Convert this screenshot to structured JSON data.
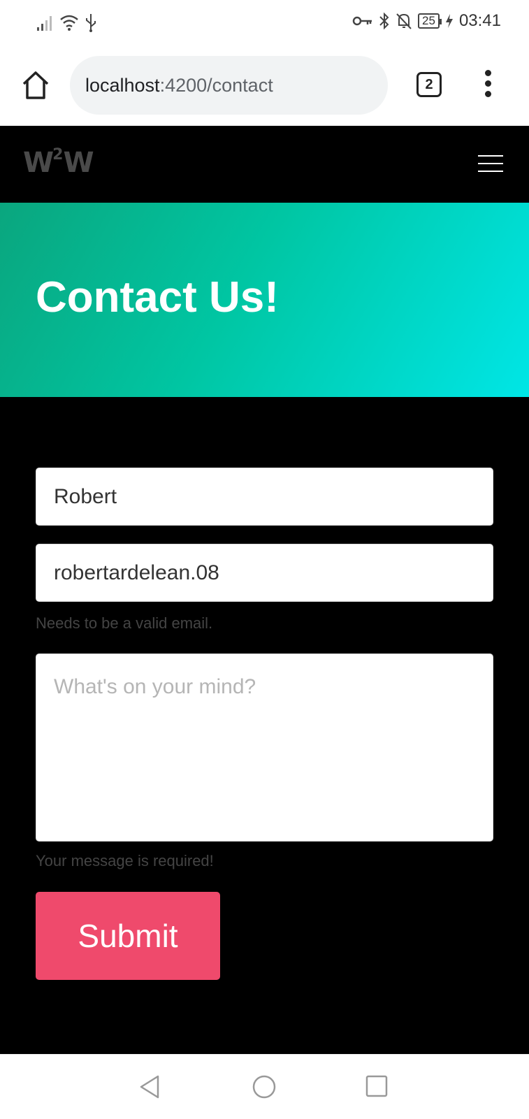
{
  "status_bar": {
    "time": "03:41",
    "battery": "25",
    "icons": [
      "signal-icon",
      "wifi-icon",
      "usb-icon",
      "vpn-key-icon",
      "bluetooth-icon",
      "mute-bell-icon",
      "battery-icon",
      "charging-icon"
    ]
  },
  "browser": {
    "url_host": "localhost",
    "url_path": ":4200/contact",
    "tab_count": "2",
    "icons": [
      "home-icon",
      "more-vert-icon"
    ]
  },
  "app": {
    "logo_main": "W",
    "logo_sup": "2",
    "logo_end": "W",
    "menu_icon": "hamburger-icon",
    "hero_title": "Contact Us!"
  },
  "form": {
    "name_value": "Robert",
    "email_value": "robertardelean.08",
    "email_hint": "Needs to be a valid email.",
    "message_placeholder": "What's on your mind?",
    "message_hint": "Your message is required!",
    "submit_label": "Submit"
  },
  "colors": {
    "submit": "#ef4a6c",
    "hero_start": "#0aa67e",
    "hero_end": "#00e6e6",
    "page_bg": "#000000"
  },
  "system_nav": [
    "back-icon",
    "home-circle-icon",
    "recents-icon"
  ]
}
